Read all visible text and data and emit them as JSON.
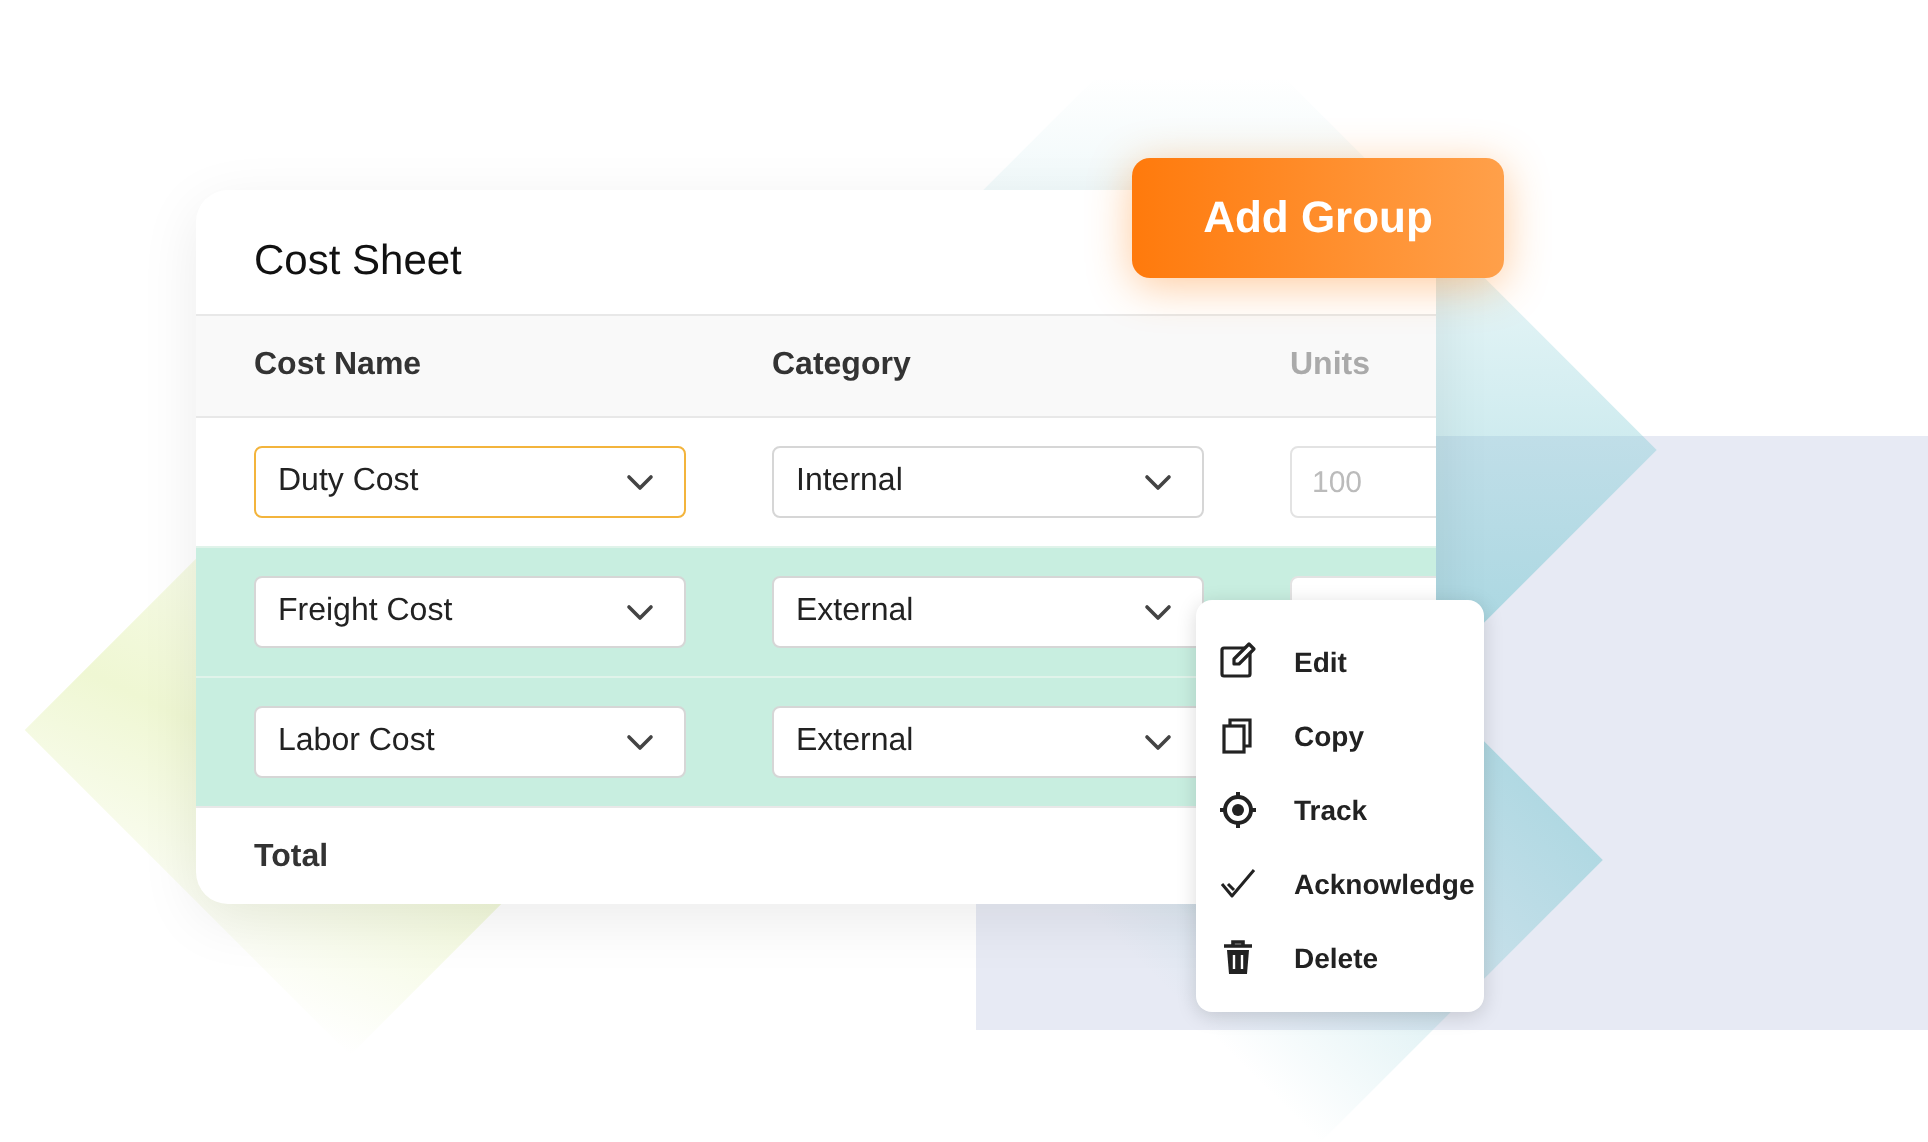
{
  "card": {
    "title": "Cost Sheet"
  },
  "add_button": {
    "label": "Add Group"
  },
  "table": {
    "columns": [
      "Cost Name",
      "Category",
      "Units"
    ],
    "rows": [
      {
        "cost_name": "Duty Cost",
        "cost_name_focused": true,
        "category": "Internal",
        "units": "100",
        "selected": false
      },
      {
        "cost_name": "Freight Cost",
        "cost_name_focused": false,
        "category": "External",
        "units_field": true,
        "selected": true
      },
      {
        "cost_name": "Labor Cost",
        "cost_name_focused": false,
        "category": "External",
        "units_field": false,
        "selected": true
      }
    ],
    "footer": "Total"
  },
  "context_menu": {
    "items": [
      {
        "kind": "edit",
        "label": "Edit"
      },
      {
        "kind": "copy",
        "label": "Copy"
      },
      {
        "kind": "track",
        "label": "Track"
      },
      {
        "kind": "check",
        "label": "Acknowledge"
      },
      {
        "kind": "delete",
        "label": "Delete"
      }
    ]
  }
}
